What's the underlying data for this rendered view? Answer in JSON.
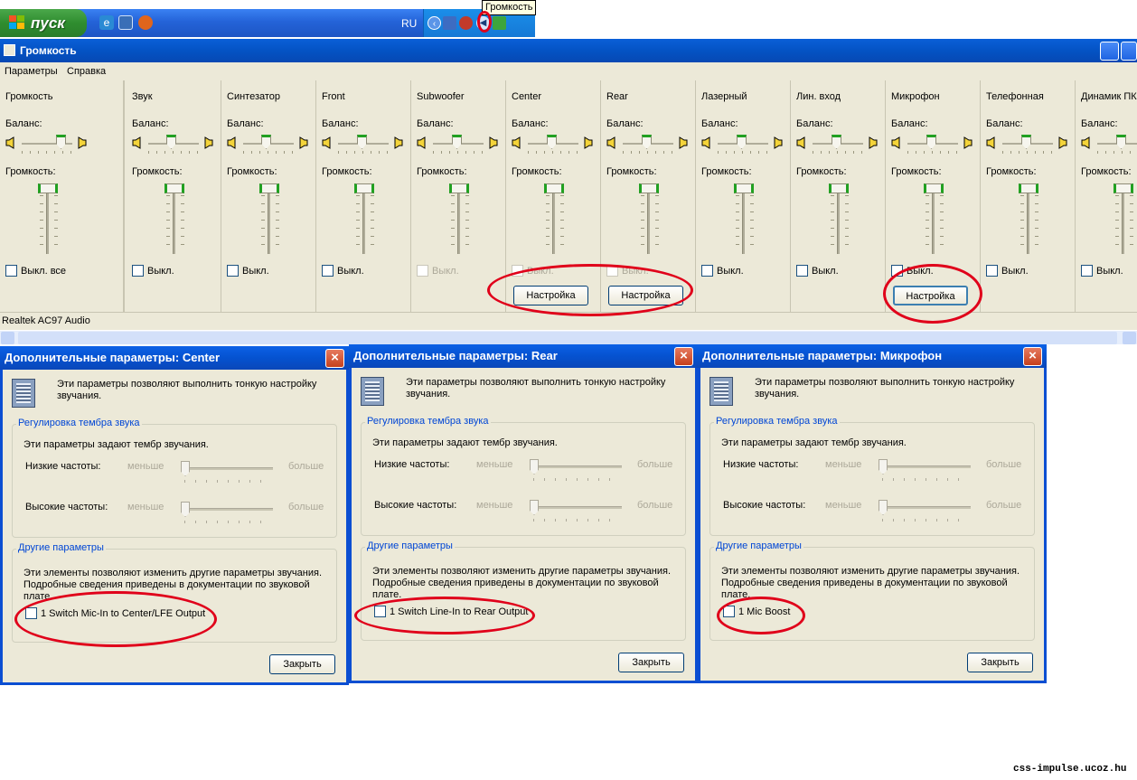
{
  "taskbar": {
    "start_label": "пуск",
    "language": "RU",
    "tooltip": "Громкость"
  },
  "mixer": {
    "title": "Громкость",
    "menu": [
      "Параметры",
      "Справка"
    ],
    "balance_label": "Баланс:",
    "volume_label": "Громкость:",
    "mute_label": "Выкл.",
    "mute_all_label": "Выкл. все",
    "advanced_label": "Настройка",
    "status": "Realtek AC97 Audio",
    "channels": [
      {
        "name": "Громкость"
      },
      {
        "name": "Звук"
      },
      {
        "name": "Синтезатор"
      },
      {
        "name": "Front"
      },
      {
        "name": "Subwoofer"
      },
      {
        "name": "Center"
      },
      {
        "name": "Rear"
      },
      {
        "name": "Лазерный"
      },
      {
        "name": "Лин. вход"
      },
      {
        "name": "Микрофон"
      },
      {
        "name": "Телефонная"
      },
      {
        "name": "Динамик ПК"
      }
    ]
  },
  "dialogs": [
    {
      "title": "Дополнительные параметры: Center",
      "intro": "Эти параметры позволяют выполнить тонкую настройку звучания.",
      "tone_group": "Регулировка тембра звука",
      "tone_text": "Эти параметры задают тембр звучания.",
      "bass": "Низкие частоты:",
      "treble": "Высокие частоты:",
      "less": "меньше",
      "more": "больше",
      "other_group": "Другие параметры",
      "other_text": "Эти элементы позволяют изменить другие параметры звучания. Подробные сведения приведены в документации по звуковой плате.",
      "option": "1  Switch Mic-In to Center/LFE Output",
      "close": "Закрыть"
    },
    {
      "title": "Дополнительные параметры: Rear",
      "intro": "Эти параметры позволяют выполнить тонкую настройку звучания.",
      "tone_group": "Регулировка тембра звука",
      "tone_text": "Эти параметры задают тембр звучания.",
      "bass": "Низкие частоты:",
      "treble": "Высокие частоты:",
      "less": "меньше",
      "more": "больше",
      "other_group": "Другие параметры",
      "other_text": "Эти элементы позволяют изменить другие параметры звучания. Подробные сведения приведены в документации по звуковой плате.",
      "option": "1  Switch Line-In to Rear Output",
      "close": "Закрыть"
    },
    {
      "title": "Дополнительные параметры: Микрофон",
      "intro": "Эти параметры позволяют выполнить тонкую настройку звучания.",
      "tone_group": "Регулировка тембра звука",
      "tone_text": "Эти параметры задают тембр звучания.",
      "bass": "Низкие частоты:",
      "treble": "Высокие частоты:",
      "less": "меньше",
      "more": "больше",
      "other_group": "Другие параметры",
      "other_text": "Эти элементы позволяют изменить другие параметры звучания. Подробные сведения приведены в документации по звуковой плате.",
      "option": "1  Mic Boost",
      "close": "Закрыть"
    }
  ],
  "watermark": "css-impulse.ucoz.hu",
  "colors": {
    "annotation": "#e0001a",
    "title_bar": "#0453c4",
    "slider_accent": "#21a121"
  }
}
